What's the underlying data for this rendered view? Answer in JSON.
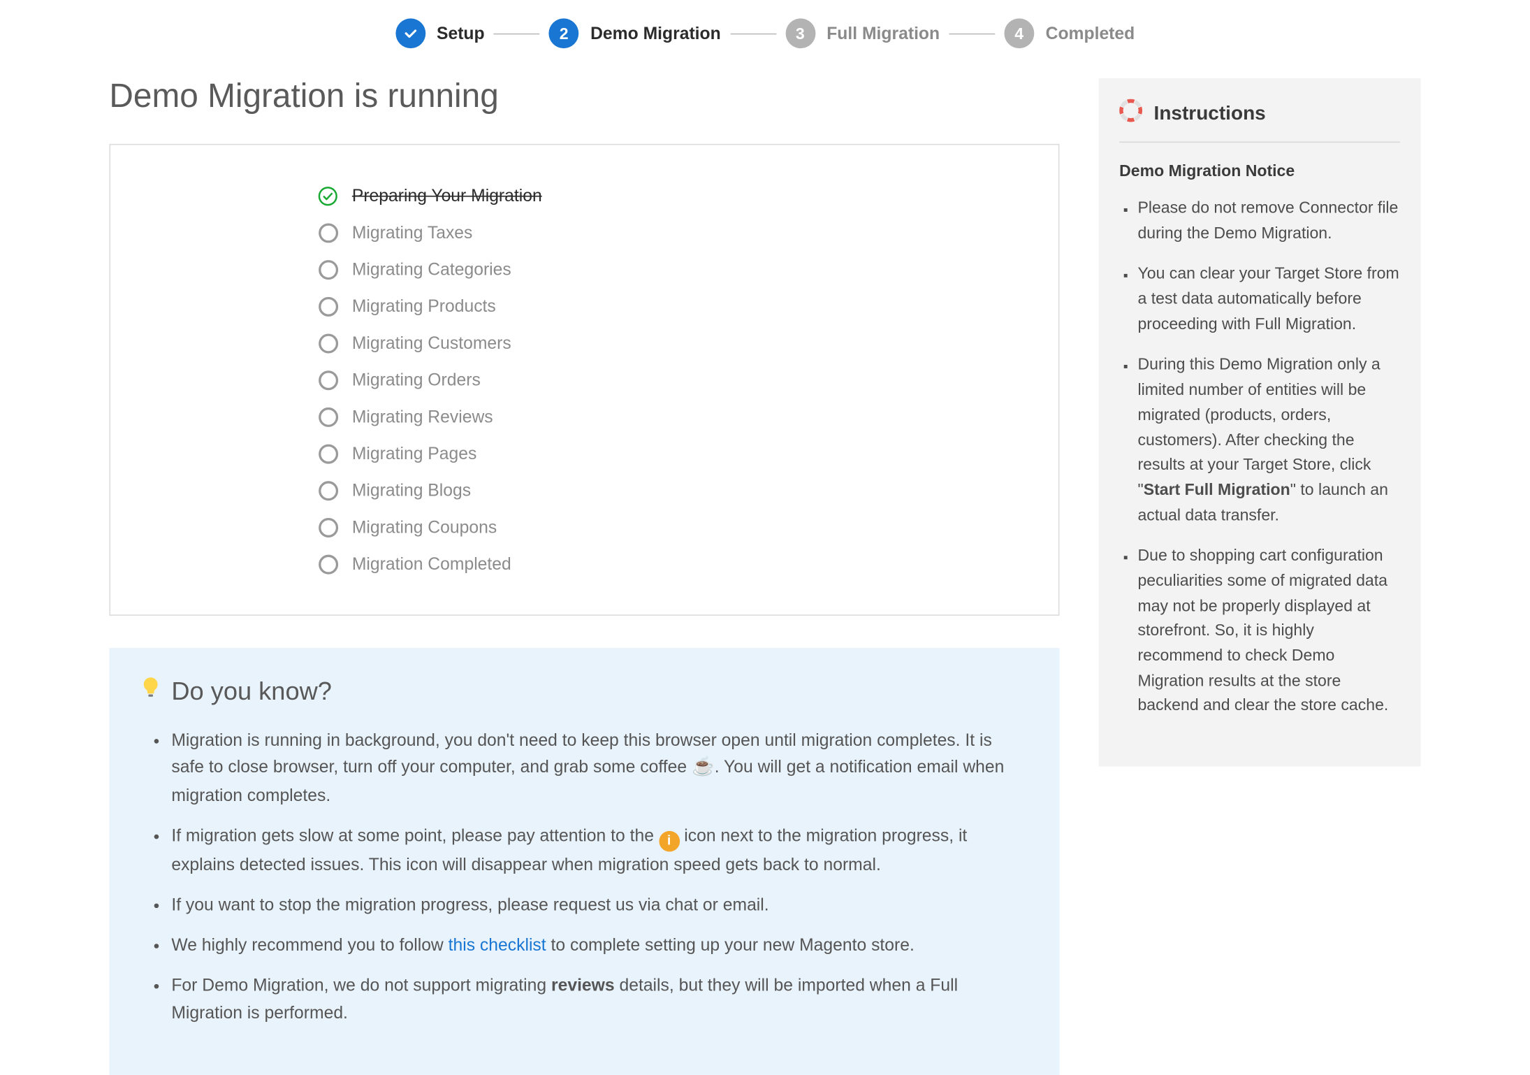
{
  "stepper": {
    "steps": [
      {
        "label": "Setup",
        "state": "done"
      },
      {
        "label": "Demo Migration",
        "state": "active",
        "number": "2"
      },
      {
        "label": "Full Migration",
        "state": "upcoming",
        "number": "3"
      },
      {
        "label": "Completed",
        "state": "upcoming",
        "number": "4"
      }
    ]
  },
  "page_title": "Demo Migration is running",
  "progress": [
    {
      "label": "Preparing Your Migration",
      "state": "done"
    },
    {
      "label": "Migrating Taxes",
      "state": "pending"
    },
    {
      "label": "Migrating Categories",
      "state": "pending"
    },
    {
      "label": "Migrating Products",
      "state": "pending"
    },
    {
      "label": "Migrating Customers",
      "state": "pending"
    },
    {
      "label": "Migrating Orders",
      "state": "pending"
    },
    {
      "label": "Migrating Reviews",
      "state": "pending"
    },
    {
      "label": "Migrating Pages",
      "state": "pending"
    },
    {
      "label": "Migrating Blogs",
      "state": "pending"
    },
    {
      "label": "Migrating Coupons",
      "state": "pending"
    },
    {
      "label": "Migration Completed",
      "state": "pending"
    }
  ],
  "tips": {
    "title": "Do you know?",
    "items": {
      "t1a": "Migration is running in background, you don't need to keep this browser open until migration completes. It is safe to close browser, turn off your computer, and grab some coffee ",
      "t1b": ". You will get a notification email when migration completes.",
      "t2a": "If migration gets slow at some point, please pay attention to the ",
      "t2b": " icon next to the migration progress, it explains detected issues. This icon will disappear when migration speed gets back to normal.",
      "t3": "If you want to stop the migration progress, please request us via chat or email.",
      "t4a": "We highly recommend you to follow ",
      "t4_link": "this checklist",
      "t4b": " to complete setting up your new Magento store.",
      "t5a": "For Demo Migration, we do not support migrating ",
      "t5_strong": "reviews",
      "t5b": " details, but they will be imported when a Full Migration is performed.",
      "info_glyph": "i"
    }
  },
  "instructions": {
    "title": "Instructions",
    "subtitle": "Demo Migration Notice",
    "items": {
      "i1": "Please do not remove Connector file during the Demo Migration.",
      "i2": "You can clear your Target Store from a test data automatically before proceeding with Full Migration.",
      "i3a": "During this Demo Migration only a limited number of entities will be migrated (products, orders, customers). After checking the results at your Target Store, click \"",
      "i3_strong": "Start Full Migration",
      "i3b": "\" to launch an actual data transfer.",
      "i4": "Due to shopping cart configuration peculiarities some of migrated data may not be properly displayed at storefront. So, it is highly recommend to check Demo Migration results at the store backend and clear the store cache."
    }
  }
}
